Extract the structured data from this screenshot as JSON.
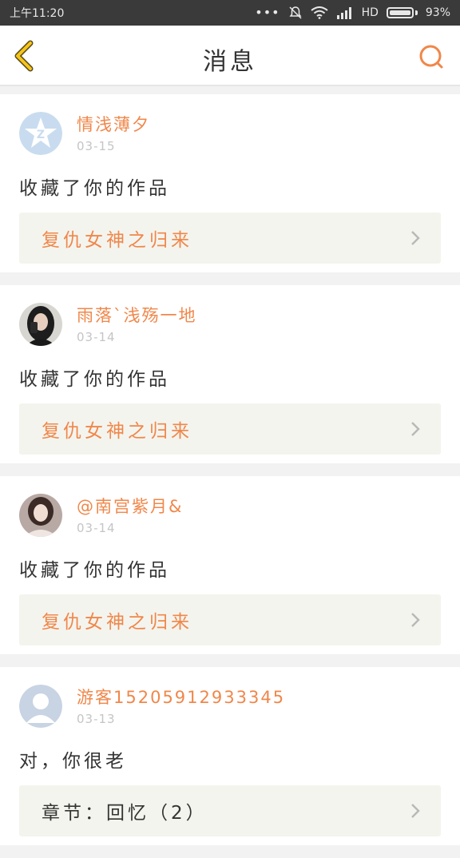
{
  "status_bar": {
    "time": "上午11:20",
    "network": "HD",
    "battery": "93%"
  },
  "header": {
    "title": "消息"
  },
  "messages": [
    {
      "username": "情浅薄夕",
      "date": "03-15",
      "action": "收藏了你的作品",
      "work_title": "复仇女神之归来",
      "avatar_icon": "qq-star-avatar"
    },
    {
      "username": "雨落`浅殇一地",
      "date": "03-14",
      "action": "收藏了你的作品",
      "work_title": "复仇女神之归来",
      "avatar_icon": "photo-avatar"
    },
    {
      "username": "@南宫紫月&",
      "date": "03-14",
      "action": "收藏了你的作品",
      "work_title": "复仇女神之归来",
      "avatar_icon": "photo-avatar"
    },
    {
      "username": "游客15205912933345",
      "date": "03-13",
      "action": "对，你很老",
      "work_title": "章节：回忆（2）",
      "avatar_icon": "default-person-avatar"
    }
  ],
  "colors": {
    "accent": "#f0874a",
    "back_icon": "#f5c518",
    "status_bg": "#3a3a3a"
  }
}
